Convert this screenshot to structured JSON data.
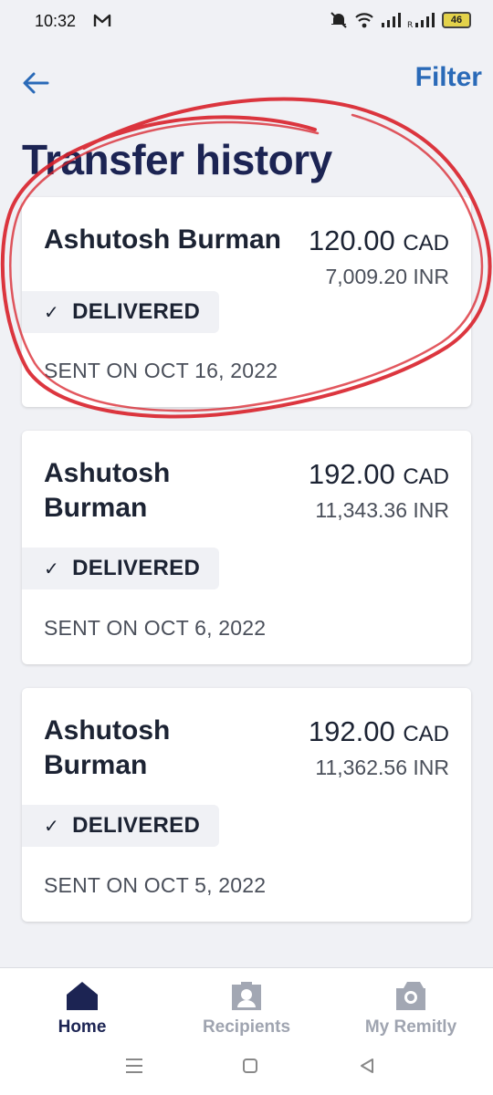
{
  "status_bar": {
    "time": "10:32",
    "battery": "46"
  },
  "header": {
    "filter_label": "Filter",
    "title": "Transfer history"
  },
  "transfers": [
    {
      "name": "Ashutosh Burman",
      "send_amount": "120.00",
      "send_currency": "CAD",
      "receive_amount": "7,009.20 INR",
      "status": "DELIVERED",
      "sent_on": "SENT ON OCT 16, 2022"
    },
    {
      "name": "Ashutosh Burman",
      "send_amount": "192.00",
      "send_currency": "CAD",
      "receive_amount": "11,343.36 INR",
      "status": "DELIVERED",
      "sent_on": "SENT ON OCT 6, 2022"
    },
    {
      "name": "Ashutosh Burman",
      "send_amount": "192.00",
      "send_currency": "CAD",
      "receive_amount": "11,362.56 INR",
      "status": "DELIVERED",
      "sent_on": "SENT ON OCT 5, 2022"
    }
  ],
  "bottom_nav": {
    "items": [
      {
        "label": "Home",
        "icon": "home-icon",
        "active": true
      },
      {
        "label": "Recipients",
        "icon": "recipients-icon",
        "active": false
      },
      {
        "label": "My Remitly",
        "icon": "my-remitly-icon",
        "active": false
      }
    ]
  },
  "colors": {
    "accent": "#2a6ab8",
    "title": "#1c2453",
    "annotation": "#d8202a",
    "nav_inactive": "#9fa4b0"
  }
}
